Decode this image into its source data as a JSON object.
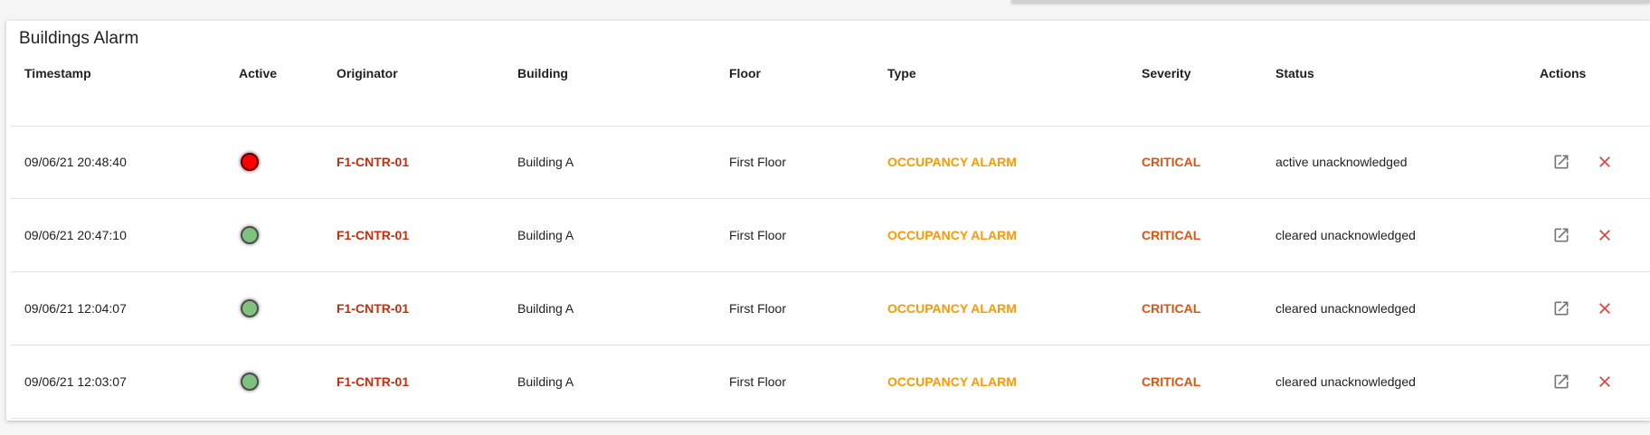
{
  "card": {
    "title": "Buildings Alarm"
  },
  "columns": {
    "timestamp": "Timestamp",
    "active": "Active",
    "originator": "Originator",
    "building": "Building",
    "floor": "Floor",
    "type": "Type",
    "severity": "Severity",
    "status": "Status",
    "actions": "Actions"
  },
  "rows": [
    {
      "timestamp": "09/06/21 20:48:40",
      "active": "red",
      "originator": "F1-CNTR-01",
      "building": "Building A",
      "floor": "First Floor",
      "type": "OCCUPANCY ALARM",
      "severity": "CRITICAL",
      "status": "active unacknowledged"
    },
    {
      "timestamp": "09/06/21 20:47:10",
      "active": "green",
      "originator": "F1-CNTR-01",
      "building": "Building A",
      "floor": "First Floor",
      "type": "OCCUPANCY ALARM",
      "severity": "CRITICAL",
      "status": "cleared unacknowledged"
    },
    {
      "timestamp": "09/06/21 12:04:07",
      "active": "green",
      "originator": "F1-CNTR-01",
      "building": "Building A",
      "floor": "First Floor",
      "type": "OCCUPANCY ALARM",
      "severity": "CRITICAL",
      "status": "cleared unacknowledged"
    },
    {
      "timestamp": "09/06/21 12:03:07",
      "active": "green",
      "originator": "F1-CNTR-01",
      "building": "Building A",
      "floor": "First Floor",
      "type": "OCCUPANCY ALARM",
      "severity": "CRITICAL",
      "status": "cleared unacknowledged"
    }
  ],
  "icons": {
    "open": "open-in-new-icon",
    "clear": "close-icon"
  },
  "colors": {
    "active_on": "#ff0000",
    "active_off": "#7ec27e",
    "originator": "#c62d0a",
    "type": "#ff9800",
    "severity": "#e0520f",
    "clear_icon": "#e53935",
    "open_icon": "#757575"
  }
}
